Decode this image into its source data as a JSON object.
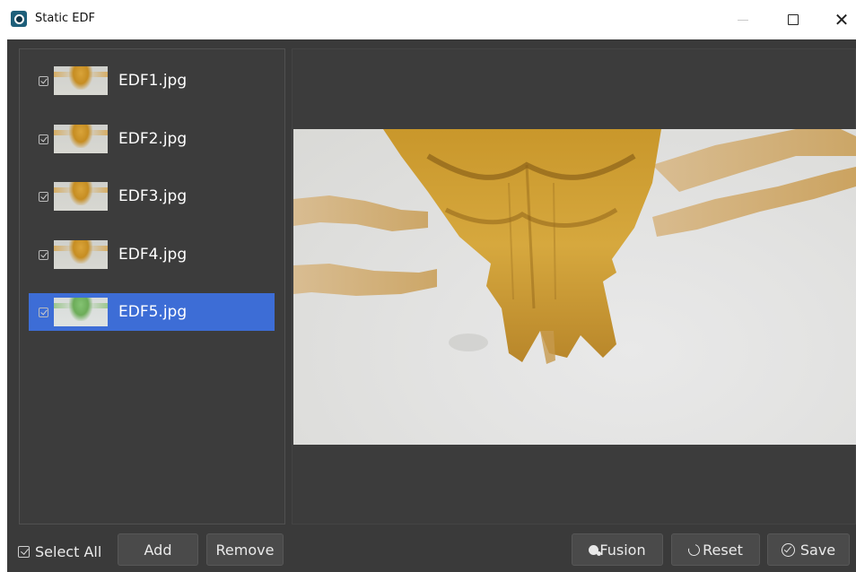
{
  "window": {
    "title": "Static EDF",
    "app_icon": "camera-eye-icon",
    "controls": [
      "minimize-icon",
      "maximize-icon",
      "close-icon"
    ],
    "close_glyph": "✕"
  },
  "files": [
    {
      "name": "EDF1.jpg",
      "checked": true,
      "selected": false
    },
    {
      "name": "EDF2.jpg",
      "checked": true,
      "selected": false
    },
    {
      "name": "EDF3.jpg",
      "checked": true,
      "selected": false
    },
    {
      "name": "EDF4.jpg",
      "checked": true,
      "selected": false
    },
    {
      "name": "EDF5.jpg",
      "checked": true,
      "selected": true
    }
  ],
  "toolbar": {
    "select_all_label": "Select All",
    "add_label": "Add",
    "remove_label": "Remove",
    "fusion_label": "Fusion",
    "reset_label": "Reset",
    "save_label": "Save"
  },
  "colors": {
    "selection": "#3d6dd6",
    "panel_bg": "#3a3a3a",
    "button_bg": "#4a4a4a"
  }
}
